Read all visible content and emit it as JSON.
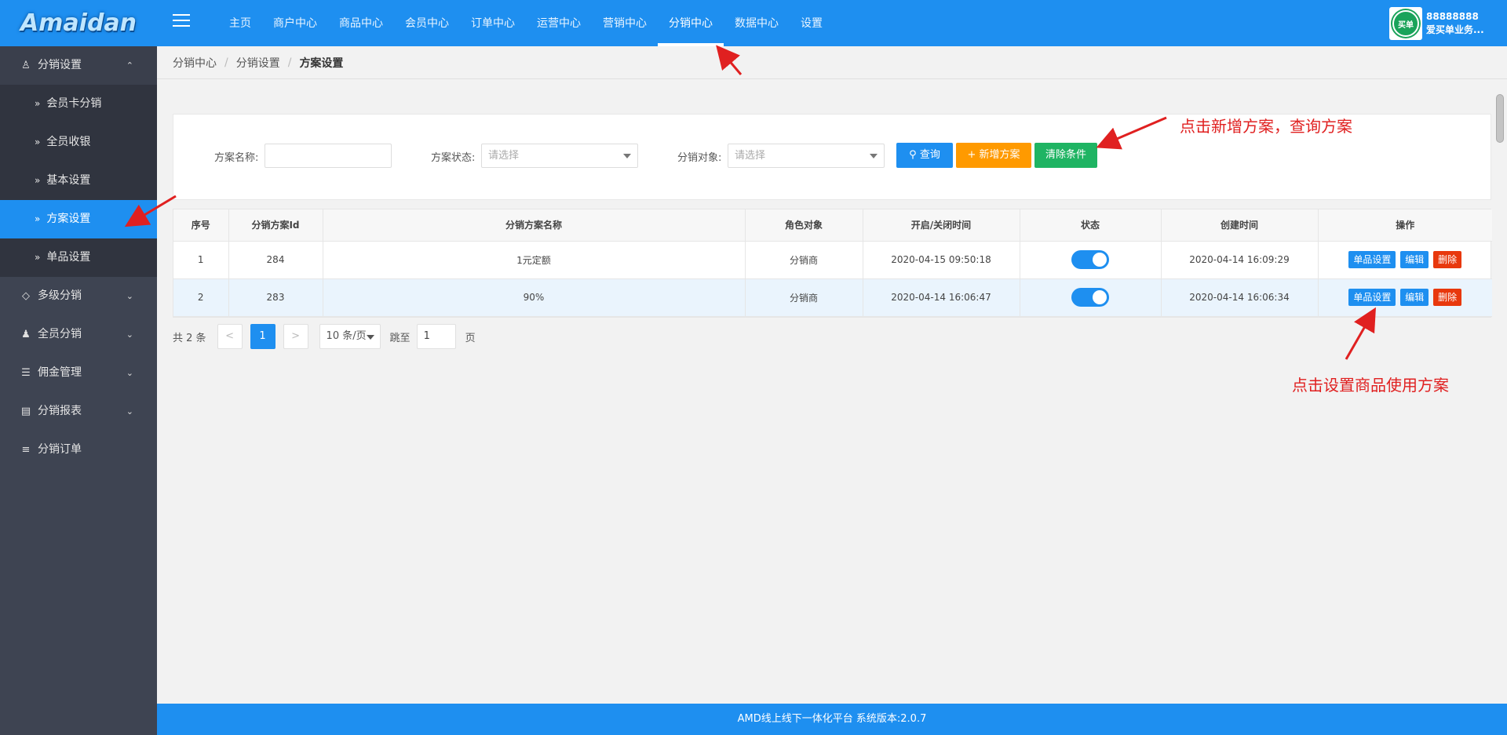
{
  "app": {
    "logo": "Amaidan"
  },
  "nav": {
    "items": [
      {
        "label": "主页"
      },
      {
        "label": "商户中心"
      },
      {
        "label": "商品中心"
      },
      {
        "label": "会员中心"
      },
      {
        "label": "订单中心"
      },
      {
        "label": "运营中心"
      },
      {
        "label": "营销中心"
      },
      {
        "label": "分销中心",
        "active": true
      },
      {
        "label": "数据中心"
      },
      {
        "label": "设置"
      }
    ]
  },
  "user": {
    "avatar_text": "买单",
    "id": "88888888",
    "name": "爱买单业务..."
  },
  "sidebar": {
    "group_main": "分销设置",
    "sub_items": [
      {
        "label": "会员卡分销"
      },
      {
        "label": "全员收银"
      },
      {
        "label": "基本设置"
      },
      {
        "label": "方案设置",
        "active": true
      },
      {
        "label": "单品设置"
      }
    ],
    "groups": [
      {
        "label": "多级分销"
      },
      {
        "label": "全员分销"
      },
      {
        "label": "佣金管理"
      },
      {
        "label": "分销报表"
      },
      {
        "label": "分销订单"
      }
    ]
  },
  "breadcrumb": [
    "分销中心",
    "分销设置",
    "方案设置"
  ],
  "filter": {
    "name_label": "方案名称:",
    "name_value": "",
    "status_label": "方案状态:",
    "status_placeholder": "请选择",
    "target_label": "分销对象:",
    "target_placeholder": "请选择",
    "query_label": "查询",
    "add_label": "新增方案",
    "clear_label": "清除条件"
  },
  "annotations": {
    "top_note": "点击新增方案，查询方案",
    "bottom_note": "点击设置商品使用方案"
  },
  "table": {
    "columns": [
      "序号",
      "分销方案Id",
      "分销方案名称",
      "角色对象",
      "开启/关闭时间",
      "状态",
      "创建时间",
      "操作"
    ],
    "rows": [
      {
        "no": "1",
        "id": "284",
        "name": "1元定额",
        "role": "分销商",
        "toggle_time": "2020-04-15 09:50:18",
        "enabled": true,
        "created": "2020-04-14 16:09:29"
      },
      {
        "no": "2",
        "id": "283",
        "name": "90%",
        "role": "分销商",
        "toggle_time": "2020-04-14 16:06:47",
        "enabled": true,
        "created": "2020-04-14 16:06:34"
      }
    ],
    "actions": {
      "item_setting": "单品设置",
      "edit": "编辑",
      "delete": "删除"
    }
  },
  "pager": {
    "total": "共 2 条",
    "prev": "<",
    "current": "1",
    "next": ">",
    "page_size": "10 条/页",
    "jump_label": "跳至",
    "jump_value": "1",
    "page_word": "页"
  },
  "footer": "AMD线上线下一体化平台 系统版本:2.0.7",
  "colors": {
    "primary": "#1e8ff0",
    "sidebar": "#3e4452",
    "orange": "#ff9a00",
    "green": "#1fb463",
    "red": "#e8380d",
    "annotation": "#e02020"
  }
}
